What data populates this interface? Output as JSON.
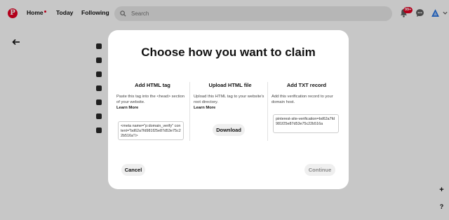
{
  "header": {
    "logo_letter": "P",
    "nav": [
      {
        "label": "Home",
        "active": true
      },
      {
        "label": "Today"
      },
      {
        "label": "Following"
      }
    ],
    "search_placeholder": "Search",
    "notifications_badge": "99+"
  },
  "modal": {
    "title": "Choose how you want to claim",
    "columns": [
      {
        "heading": "Add HTML tag",
        "description": "Paste this tag into the <head> section of your website.",
        "learn_more": "Learn More",
        "code": "<meta name=\"p:domain_verify\" content=\"bd62a7fd981f25e87d53e75c22b516a\"/>"
      },
      {
        "heading": "Upload HTML file",
        "description": "Upload this HTML tag to your website's root directory.",
        "learn_more": "Learn More",
        "button": "Download"
      },
      {
        "heading": "Add TXT record",
        "description": "Add this verification record to your domain host.",
        "code": "pinterest-site-verification=bd62a7fd981f25e87d53e75c22b516a"
      }
    ],
    "cancel_label": "Cancel",
    "continue_label": "Continue"
  },
  "colors": {
    "brand": "#e60023",
    "overlay": "rgba(0,0,0,0.22)",
    "button_bg": "#efefef"
  },
  "icons": [
    "pinterest-logo-icon",
    "search-icon",
    "bell-icon",
    "message-icon",
    "profile-icon",
    "chevron-down-icon",
    "back-arrow-icon",
    "plus-icon",
    "help-icon"
  ]
}
